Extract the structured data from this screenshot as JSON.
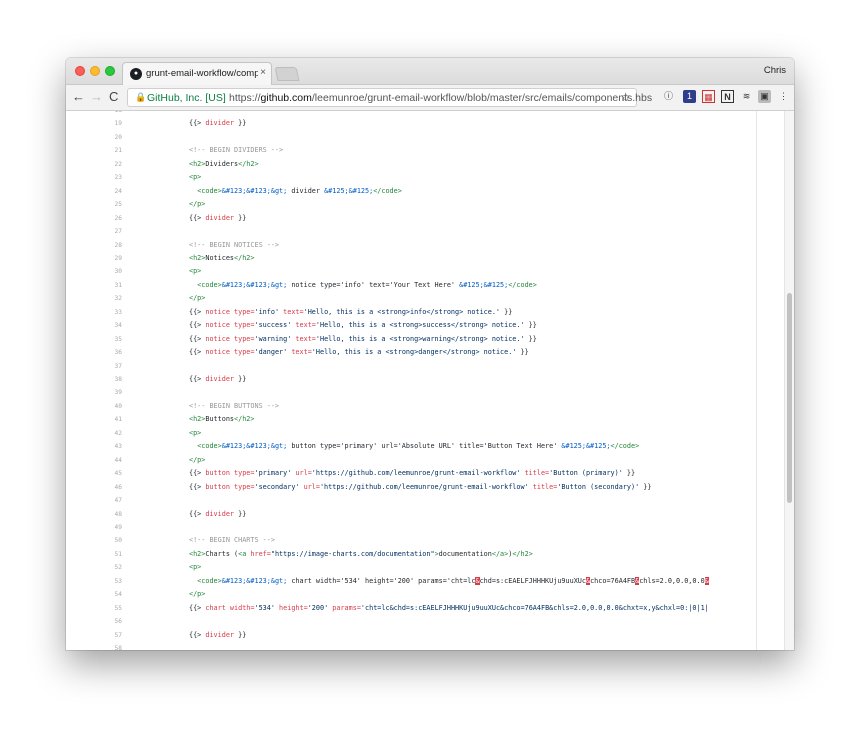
{
  "browser": {
    "tab_title": "grunt-email-workflow/compon",
    "tab_close": "×",
    "profile_name": "Chris",
    "nav": {
      "back": "←",
      "forward": "→",
      "reload": "C"
    },
    "security_label": "GitHub, Inc. [US]",
    "url_prefix": "https://",
    "url_host": "github.com",
    "url_path": "/leemunroe/grunt-email-workflow/blob/master/src/emails/components.hbs",
    "extensions": [
      "info-icon",
      "notification-icon",
      "qr-icon",
      "notion-icon",
      "layers-icon",
      "ext-icon",
      "menu-icon"
    ]
  },
  "code": {
    "lines": [
      {
        "n": "18",
        "parts": []
      },
      {
        "n": "19",
        "parts": [
          {
            "c": "",
            "t": "{{> "
          },
          {
            "c": "c-hb",
            "t": "divider"
          },
          {
            "c": "",
            "t": " }}"
          }
        ]
      },
      {
        "n": "20",
        "parts": []
      },
      {
        "n": "21",
        "parts": [
          {
            "c": "c-comment",
            "t": "<!-- BEGIN DIVIDERS -->"
          }
        ]
      },
      {
        "n": "22",
        "parts": [
          {
            "c": "c-tag",
            "t": "<h2>"
          },
          {
            "c": "",
            "t": "Dividers"
          },
          {
            "c": "c-tag",
            "t": "</h2>"
          }
        ]
      },
      {
        "n": "23",
        "parts": [
          {
            "c": "c-tag",
            "t": "<p>"
          }
        ]
      },
      {
        "n": "24",
        "parts": [
          {
            "c": "",
            "t": "  "
          },
          {
            "c": "c-tag",
            "t": "<code>"
          },
          {
            "c": "c-ent",
            "t": "&#123;&#123;&gt;"
          },
          {
            "c": "",
            "t": " divider "
          },
          {
            "c": "c-ent",
            "t": "&#125;&#125;"
          },
          {
            "c": "c-tag",
            "t": "</code>"
          }
        ]
      },
      {
        "n": "25",
        "parts": [
          {
            "c": "c-tag",
            "t": "</p>"
          }
        ]
      },
      {
        "n": "26",
        "parts": [
          {
            "c": "",
            "t": "{{> "
          },
          {
            "c": "c-hb",
            "t": "divider"
          },
          {
            "c": "",
            "t": " }}"
          }
        ]
      },
      {
        "n": "27",
        "parts": []
      },
      {
        "n": "28",
        "parts": [
          {
            "c": "c-comment",
            "t": "<!-- BEGIN NOTICES -->"
          }
        ]
      },
      {
        "n": "29",
        "parts": [
          {
            "c": "c-tag",
            "t": "<h2>"
          },
          {
            "c": "",
            "t": "Notices"
          },
          {
            "c": "c-tag",
            "t": "</h2>"
          }
        ]
      },
      {
        "n": "30",
        "parts": [
          {
            "c": "c-tag",
            "t": "<p>"
          }
        ]
      },
      {
        "n": "31",
        "parts": [
          {
            "c": "",
            "t": "  "
          },
          {
            "c": "c-tag",
            "t": "<code>"
          },
          {
            "c": "c-ent",
            "t": "&#123;&#123;&gt;"
          },
          {
            "c": "",
            "t": " notice type='info' text='Your Text Here' "
          },
          {
            "c": "c-ent",
            "t": "&#125;&#125;"
          },
          {
            "c": "c-tag",
            "t": "</code>"
          }
        ]
      },
      {
        "n": "32",
        "parts": [
          {
            "c": "c-tag",
            "t": "</p>"
          }
        ]
      },
      {
        "n": "33",
        "parts": [
          {
            "c": "",
            "t": "{{> "
          },
          {
            "c": "c-hb",
            "t": "notice type="
          },
          {
            "c": "c-str",
            "t": "'info'"
          },
          {
            "c": "c-hb",
            "t": " text="
          },
          {
            "c": "c-str",
            "t": "'Hello, this is a <strong>info</strong> notice.'"
          },
          {
            "c": "",
            "t": " }}"
          }
        ]
      },
      {
        "n": "34",
        "parts": [
          {
            "c": "",
            "t": "{{> "
          },
          {
            "c": "c-hb",
            "t": "notice type="
          },
          {
            "c": "c-str",
            "t": "'success'"
          },
          {
            "c": "c-hb",
            "t": " text="
          },
          {
            "c": "c-str",
            "t": "'Hello, this is a <strong>success</strong> notice.'"
          },
          {
            "c": "",
            "t": " }}"
          }
        ]
      },
      {
        "n": "35",
        "parts": [
          {
            "c": "",
            "t": "{{> "
          },
          {
            "c": "c-hb",
            "t": "notice type="
          },
          {
            "c": "c-str",
            "t": "'warning'"
          },
          {
            "c": "c-hb",
            "t": " text="
          },
          {
            "c": "c-str",
            "t": "'Hello, this is a <strong>warning</strong> notice.'"
          },
          {
            "c": "",
            "t": " }}"
          }
        ]
      },
      {
        "n": "36",
        "parts": [
          {
            "c": "",
            "t": "{{> "
          },
          {
            "c": "c-hb",
            "t": "notice type="
          },
          {
            "c": "c-str",
            "t": "'danger'"
          },
          {
            "c": "c-hb",
            "t": " text="
          },
          {
            "c": "c-str",
            "t": "'Hello, this is a <strong>danger</strong> notice.'"
          },
          {
            "c": "",
            "t": " }}"
          }
        ]
      },
      {
        "n": "37",
        "parts": []
      },
      {
        "n": "38",
        "parts": [
          {
            "c": "",
            "t": "{{> "
          },
          {
            "c": "c-hb",
            "t": "divider"
          },
          {
            "c": "",
            "t": " }}"
          }
        ]
      },
      {
        "n": "39",
        "parts": []
      },
      {
        "n": "40",
        "parts": [
          {
            "c": "c-comment",
            "t": "<!-- BEGIN BUTTONS -->"
          }
        ]
      },
      {
        "n": "41",
        "parts": [
          {
            "c": "c-tag",
            "t": "<h2>"
          },
          {
            "c": "",
            "t": "Buttons"
          },
          {
            "c": "c-tag",
            "t": "</h2>"
          }
        ]
      },
      {
        "n": "42",
        "parts": [
          {
            "c": "c-tag",
            "t": "<p>"
          }
        ]
      },
      {
        "n": "43",
        "parts": [
          {
            "c": "",
            "t": "  "
          },
          {
            "c": "c-tag",
            "t": "<code>"
          },
          {
            "c": "c-ent",
            "t": "&#123;&#123;&gt;"
          },
          {
            "c": "",
            "t": " button type='primary' url='Absolute URL' title='Button Text Here' "
          },
          {
            "c": "c-ent",
            "t": "&#125;&#125;"
          },
          {
            "c": "c-tag",
            "t": "</code>"
          }
        ]
      },
      {
        "n": "44",
        "parts": [
          {
            "c": "c-tag",
            "t": "</p>"
          }
        ]
      },
      {
        "n": "45",
        "parts": [
          {
            "c": "",
            "t": "{{> "
          },
          {
            "c": "c-hb",
            "t": "button type="
          },
          {
            "c": "c-str",
            "t": "'primary'"
          },
          {
            "c": "c-hb",
            "t": " url="
          },
          {
            "c": "c-str",
            "t": "'https://github.com/leemunroe/grunt-email-workflow'"
          },
          {
            "c": "c-hb",
            "t": " title="
          },
          {
            "c": "c-str",
            "t": "'Button (primary)'"
          },
          {
            "c": "",
            "t": " }}"
          }
        ]
      },
      {
        "n": "46",
        "parts": [
          {
            "c": "",
            "t": "{{> "
          },
          {
            "c": "c-hb",
            "t": "button type="
          },
          {
            "c": "c-str",
            "t": "'secondary'"
          },
          {
            "c": "c-hb",
            "t": " url="
          },
          {
            "c": "c-str",
            "t": "'https://github.com/leemunroe/grunt-email-workflow'"
          },
          {
            "c": "c-hb",
            "t": " title="
          },
          {
            "c": "c-str",
            "t": "'Button (secondary)'"
          },
          {
            "c": "",
            "t": " }}"
          }
        ]
      },
      {
        "n": "47",
        "parts": []
      },
      {
        "n": "48",
        "parts": [
          {
            "c": "",
            "t": "{{> "
          },
          {
            "c": "c-hb",
            "t": "divider"
          },
          {
            "c": "",
            "t": " }}"
          }
        ]
      },
      {
        "n": "49",
        "parts": []
      },
      {
        "n": "50",
        "parts": [
          {
            "c": "c-comment",
            "t": "<!-- BEGIN CHARTS -->"
          }
        ]
      },
      {
        "n": "51",
        "parts": [
          {
            "c": "c-tag",
            "t": "<h2>"
          },
          {
            "c": "",
            "t": "Charts ("
          },
          {
            "c": "c-tag",
            "t": "<a "
          },
          {
            "c": "c-hb",
            "t": "href="
          },
          {
            "c": "c-str",
            "t": "\"https://image-charts.com/documentation\""
          },
          {
            "c": "c-tag",
            "t": ">"
          },
          {
            "c": "",
            "t": "documentation"
          },
          {
            "c": "c-tag",
            "t": "</a>"
          },
          {
            "c": "",
            "t": ")"
          },
          {
            "c": "c-tag",
            "t": "</h2>"
          }
        ]
      },
      {
        "n": "52",
        "parts": [
          {
            "c": "c-tag",
            "t": "<p>"
          }
        ]
      },
      {
        "n": "53",
        "parts": [
          {
            "c": "",
            "t": "  "
          },
          {
            "c": "c-tag",
            "t": "<code>"
          },
          {
            "c": "c-ent",
            "t": "&#123;&#123;&gt;"
          },
          {
            "c": "",
            "t": " chart width='534' height='200' params='cht=lc"
          },
          {
            "c": "c-err",
            "t": "&"
          },
          {
            "c": "",
            "t": "chd=s:cEAELFJHHHKUju9uuXUc"
          },
          {
            "c": "c-err",
            "t": "&"
          },
          {
            "c": "",
            "t": "chco=76A4FB"
          },
          {
            "c": "c-err",
            "t": "&"
          },
          {
            "c": "",
            "t": "chls=2.0,0.0,0.0"
          },
          {
            "c": "c-err",
            "t": "&"
          }
        ]
      },
      {
        "n": "54",
        "parts": [
          {
            "c": "c-tag",
            "t": "</p>"
          }
        ]
      },
      {
        "n": "55",
        "parts": [
          {
            "c": "",
            "t": "{{> "
          },
          {
            "c": "c-hb",
            "t": "chart width="
          },
          {
            "c": "c-str",
            "t": "'534'"
          },
          {
            "c": "c-hb",
            "t": " height="
          },
          {
            "c": "c-str",
            "t": "'200'"
          },
          {
            "c": "c-hb",
            "t": " params="
          },
          {
            "c": "c-str",
            "t": "'cht=lc&chd=s:cEAELFJHHHKUju9uuXUc&chco=76A4FB&chls=2.0,0.0,0.0&chxt=x,y&chxl=0:|0|1|"
          }
        ]
      },
      {
        "n": "56",
        "parts": []
      },
      {
        "n": "57",
        "parts": [
          {
            "c": "",
            "t": "{{> "
          },
          {
            "c": "c-hb",
            "t": "divider"
          },
          {
            "c": "",
            "t": " }}"
          }
        ]
      },
      {
        "n": "58",
        "parts": []
      }
    ]
  }
}
